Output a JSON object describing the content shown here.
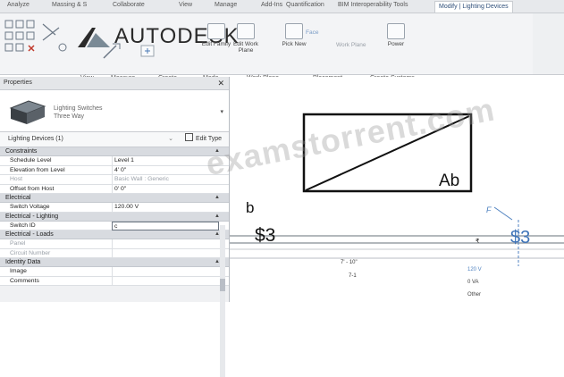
{
  "ribbon_tabs": [
    {
      "label": "Analyze",
      "active": false
    },
    {
      "label": "Massing & S",
      "active": false
    },
    {
      "label": "Collaborate",
      "active": false
    },
    {
      "label": "View",
      "active": false
    },
    {
      "label": "Manage",
      "active": false
    },
    {
      "label": "Add-Ins",
      "active": false
    },
    {
      "label": "Quantification",
      "active": false
    },
    {
      "label": "BIM Interoperability Tools",
      "active": false
    },
    {
      "label": "Modify | Lighting Devices",
      "active": true
    }
  ],
  "logo_text": "AUTODESK",
  "ribbon_buttons": [
    {
      "label": "Edit Family",
      "icon": "edit-family-icon"
    },
    {
      "label": "Edit Work Plane",
      "icon": "edit-work-plane-icon"
    },
    {
      "label": "Pick New",
      "icon": "pick-new-icon"
    },
    {
      "label": "Face",
      "icon": "face-icon"
    },
    {
      "label": "Work Plane",
      "icon": "work-plane-icon"
    },
    {
      "label": "Power",
      "icon": "power-icon"
    }
  ],
  "ribbon_panels": [
    "View",
    "Measure",
    "Create",
    "Mode",
    "Work Plane",
    "Placement",
    "Create Systems"
  ],
  "properties": {
    "title": "Properties",
    "type_name": "Lighting Switches",
    "type_sub": "Three Way",
    "filter": "Lighting Devices (1)",
    "edit_type": "Edit Type",
    "sections": [
      {
        "name": "Constraints",
        "rows": [
          {
            "key": "Schedule Level",
            "value": "Level 1",
            "disabled": false,
            "input": false
          },
          {
            "key": "Elevation from Level",
            "value": "4' 0\"",
            "disabled": false,
            "input": false
          },
          {
            "key": "Host",
            "value": "Basic Wall : Generic",
            "disabled": true,
            "input": false
          },
          {
            "key": "Offset from Host",
            "value": "0' 0\"",
            "disabled": false,
            "input": false
          }
        ]
      },
      {
        "name": "Electrical",
        "rows": [
          {
            "key": "Switch Voltage",
            "value": "120.00 V",
            "disabled": false,
            "input": false
          }
        ]
      },
      {
        "name": "Electrical - Lighting",
        "rows": [
          {
            "key": "Switch ID",
            "value": "c",
            "disabled": false,
            "input": true
          }
        ]
      },
      {
        "name": "Electrical - Loads",
        "rows": [
          {
            "key": "Panel",
            "value": "",
            "disabled": true,
            "input": false
          },
          {
            "key": "Circuit Number",
            "value": "",
            "disabled": true,
            "input": false
          }
        ]
      },
      {
        "name": "Identity Data",
        "rows": [
          {
            "key": "Image",
            "value": "",
            "disabled": false,
            "input": false
          },
          {
            "key": "Comments",
            "value": "",
            "disabled": false,
            "input": false
          }
        ]
      }
    ]
  },
  "canvas": {
    "box_label": "Ab",
    "tag_b": "b",
    "switch_left": "$3",
    "switch_right": "$3",
    "dim_text": "7' - 10\"",
    "dim_sub": "7-1",
    "right_labels": [
      "120 V",
      "0 VA",
      "Other"
    ],
    "tag_small": "F",
    "watermark": "examstorrent.com"
  }
}
